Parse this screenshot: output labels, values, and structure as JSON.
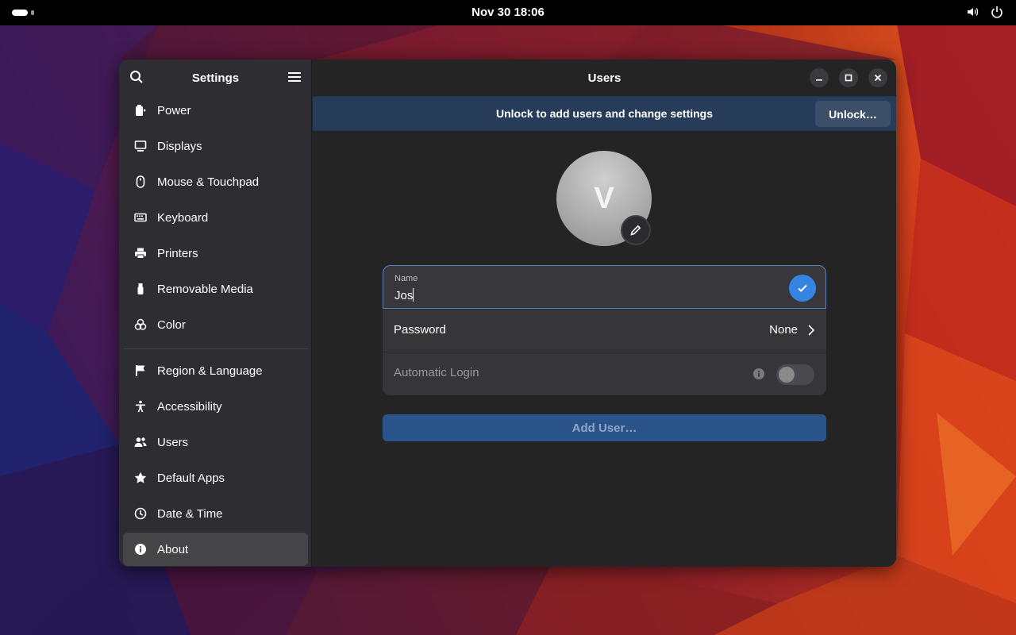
{
  "topbar": {
    "clock": "Nov 30  18:06",
    "icons": [
      "activities-indicator",
      "volume-icon",
      "power-icon"
    ]
  },
  "sidebar": {
    "title": "Settings",
    "items": [
      {
        "label": "Power",
        "icon": "power-plug-icon"
      },
      {
        "label": "Displays",
        "icon": "display-icon"
      },
      {
        "label": "Mouse & Touchpad",
        "icon": "mouse-icon"
      },
      {
        "label": "Keyboard",
        "icon": "keyboard-icon"
      },
      {
        "label": "Printers",
        "icon": "printer-icon"
      },
      {
        "label": "Removable Media",
        "icon": "usb-icon"
      },
      {
        "label": "Color",
        "icon": "color-icon"
      },
      {
        "label": "Region & Language",
        "icon": "flag-icon"
      },
      {
        "label": "Accessibility",
        "icon": "accessibility-icon"
      },
      {
        "label": "Users",
        "icon": "users-icon"
      },
      {
        "label": "Default Apps",
        "icon": "star-icon"
      },
      {
        "label": "Date & Time",
        "icon": "clock-icon"
      },
      {
        "label": "About",
        "icon": "info-icon",
        "selected": true
      }
    ]
  },
  "main": {
    "title": "Users",
    "infobar_text": "Unlock to add users and change settings",
    "unlock_label": "Unlock…",
    "avatar_letter": "V",
    "name_label": "Name",
    "name_value": "Jos",
    "password_label": "Password",
    "password_value": "None",
    "autologin_label": "Automatic Login",
    "autologin_enabled": false,
    "add_user_label": "Add User…"
  },
  "colors": {
    "accent": "#3584e4",
    "infobar": "#263c59",
    "window_bg": "#242424",
    "sidebar_bg": "#2e2e32"
  }
}
